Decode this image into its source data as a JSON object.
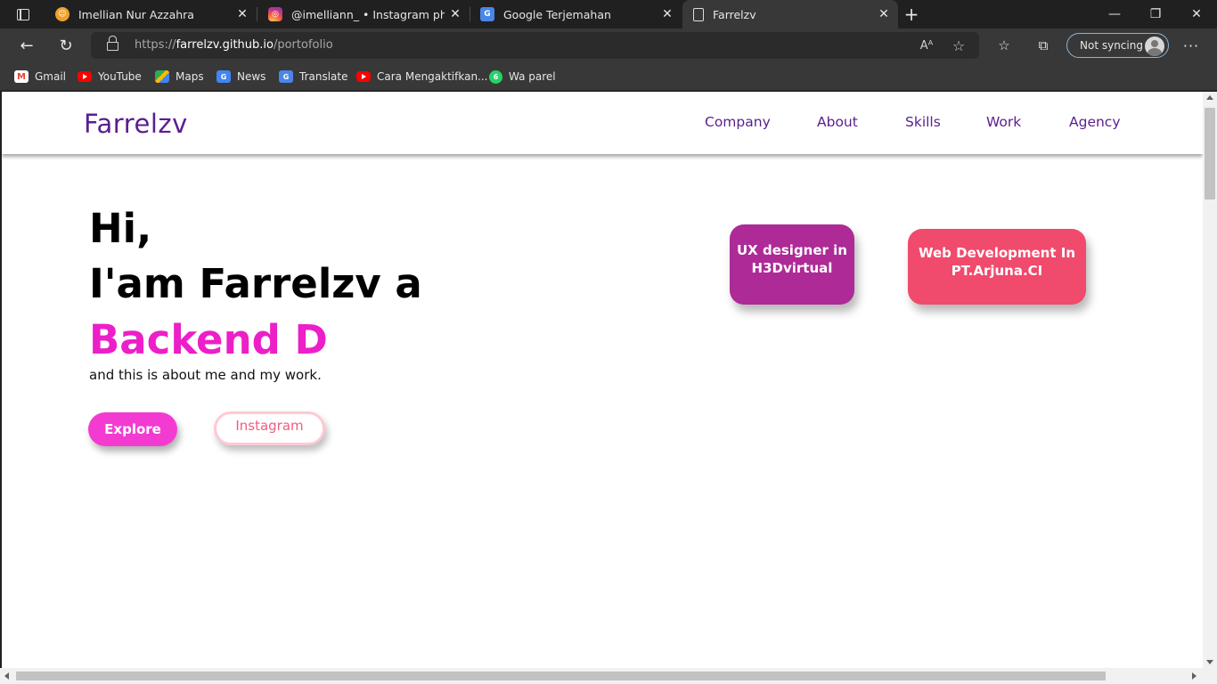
{
  "browser": {
    "tabs": [
      {
        "title": "Imellian Nur Azzahra",
        "icon": "avatar-favicon"
      },
      {
        "title": "@imelliann_ • Instagram photos",
        "icon": "instagram-favicon"
      },
      {
        "title": "Google Terjemahan",
        "icon": "google-translate-favicon"
      },
      {
        "title": "Farrelzv",
        "icon": "document-favicon",
        "active": true
      }
    ],
    "address": {
      "scheme": "https://",
      "host": "farrelzv.github.io",
      "path": "/portofolio"
    },
    "profile_label": "Not syncing",
    "bookmarks": [
      {
        "label": "Gmail",
        "icon": "gmail-icon"
      },
      {
        "label": "YouTube",
        "icon": "youtube-icon"
      },
      {
        "label": "Maps",
        "icon": "maps-icon"
      },
      {
        "label": "News",
        "icon": "news-icon"
      },
      {
        "label": "Translate",
        "icon": "translate-icon"
      },
      {
        "label": "Cara Mengaktifkan...",
        "icon": "youtube-icon"
      },
      {
        "label": "Wa parel",
        "icon": "whatsapp-icon"
      }
    ],
    "colors": {
      "frame": "#202020",
      "toolbar": "#383838",
      "profile_border": "#8ab4d8"
    }
  },
  "site": {
    "logo": "Farrelzv",
    "nav": [
      "Company",
      "About",
      "Skills",
      "Work",
      "Agency"
    ],
    "hero": {
      "greeting": "Hi,",
      "intro": "I'am Farrelzv a",
      "role": "Backend D",
      "subtitle": "and this is about me and my work."
    },
    "buttons": {
      "explore": "Explore",
      "instagram": "Instagram"
    },
    "cards": [
      {
        "line1": "UX designer in",
        "line2": "H3Dvirtual",
        "color": "#ae2a96"
      },
      {
        "line1": "Web Development In",
        "line2": "PT.Arjuna.CI",
        "color": "#f04a6d"
      }
    ],
    "colors": {
      "brand": "#5b1e8f",
      "accent": "#ec1fc8",
      "explore_button": "#f33bd2",
      "instagram_text": "#f05d7d"
    }
  }
}
